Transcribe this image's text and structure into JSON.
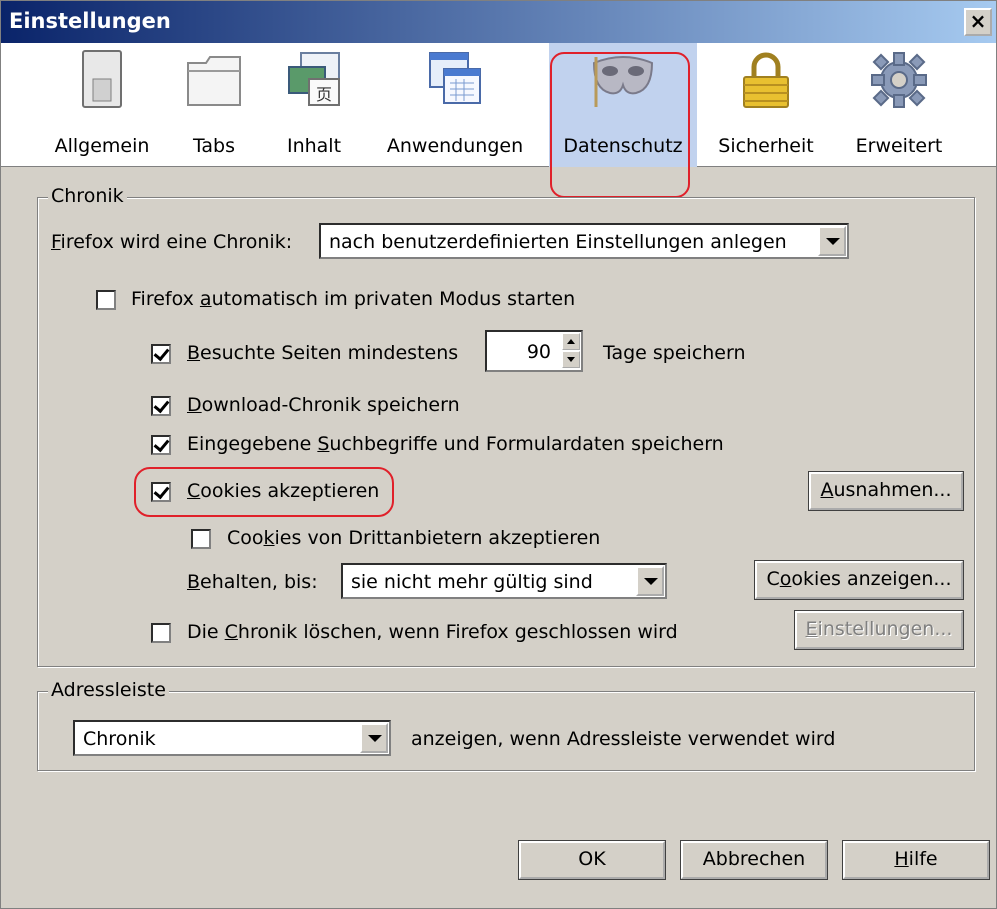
{
  "window": {
    "title": "Einstellungen",
    "close_symbol": "×"
  },
  "toolbar": {
    "items": [
      {
        "label": "Allgemein",
        "icon": "switch-icon"
      },
      {
        "label": "Tabs",
        "icon": "tabs-icon"
      },
      {
        "label": "Inhalt",
        "icon": "content-icon"
      },
      {
        "label": "Anwendungen",
        "icon": "applications-icon"
      },
      {
        "label": "Datenschutz",
        "icon": "privacy-mask-icon",
        "selected": true
      },
      {
        "label": "Sicherheit",
        "icon": "lock-icon"
      },
      {
        "label": "Erweitert",
        "icon": "gear-icon"
      }
    ]
  },
  "history": {
    "legend": "Chronik",
    "mode_label_prefix": "F",
    "mode_label_rest": "irefox wird eine Chronik:",
    "mode_value": "nach benutzerdefinierten Einstellungen anlegen",
    "private_mode": {
      "pre": "Firefox ",
      "u": "a",
      "post": "utomatisch im privaten Modus starten",
      "checked": false
    },
    "visited_pages": {
      "u": "B",
      "post": "esuchte Seiten mindestens",
      "checked": true
    },
    "visited_days": "90",
    "days_suffix": "Tage speichern",
    "download_history": {
      "u": "D",
      "post": "ownload-Chronik speichern",
      "checked": true
    },
    "search_form": {
      "pre": "Eingegebene ",
      "u": "S",
      "post": "uchbegriffe und Formulardaten speichern",
      "checked": true
    },
    "accept_cookies": {
      "u": "C",
      "post": "ookies akzeptieren",
      "checked": true
    },
    "exceptions_button": {
      "u": "A",
      "post": "usnahmen..."
    },
    "third_party": {
      "pre": "Coo",
      "u": "k",
      "post": "ies von Drittanbietern akzeptieren",
      "checked": false
    },
    "keep_until_label": {
      "u": "B",
      "post": "ehalten, bis:"
    },
    "keep_until_value": "sie nicht mehr gültig sind",
    "show_cookies_button": {
      "pre": "C",
      "u": "o",
      "post": "okies anzeigen..."
    },
    "clear_on_close": {
      "pre": "Die ",
      "u": "C",
      "post": "hronik löschen, wenn Firefox geschlossen wird",
      "checked": false
    },
    "settings_button": {
      "u": "E",
      "post": "instellungen..."
    }
  },
  "addressbar": {
    "legend": "Adressleiste",
    "value": "Chronik",
    "suffix": "anzeigen, wenn Adressleiste verwendet wird"
  },
  "footer": {
    "ok": "OK",
    "cancel": "Abbrechen",
    "help_u": "H",
    "help_post": "ilfe"
  }
}
